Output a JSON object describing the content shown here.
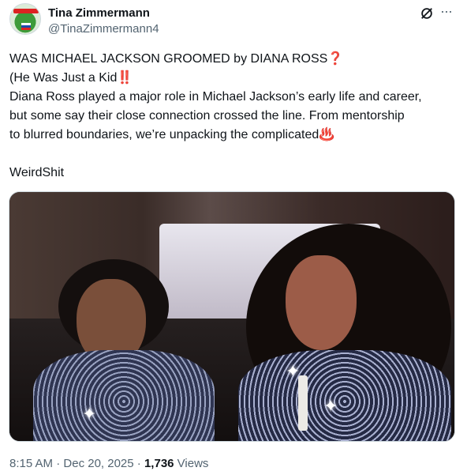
{
  "author": {
    "name": "Tina Zimmermann",
    "handle": "@TinaZimmermann4"
  },
  "header": {
    "grok_icon": "grok-icon",
    "more_icon": "more-horizontal-icon",
    "more_glyph": "···"
  },
  "tweet": {
    "lines": [
      "WAS MICHAEL JACKSON GROOMED by DIANA ROSS❓",
      " (He Was Just a Kid‼️",
      "Diana Ross played a major role in Michael Jackson’s early life and career,",
      "but some say their close connection crossed the line. From mentorship",
      "to blurred boundaries, we’re unpacking the complicated♨️"
    ],
    "hashtag_line": "WeirdShit"
  },
  "meta": {
    "time": "8:15 AM",
    "separator": " · ",
    "date": "Dec 20, 2025",
    "views_count": "1,736",
    "views_label": " Views"
  }
}
